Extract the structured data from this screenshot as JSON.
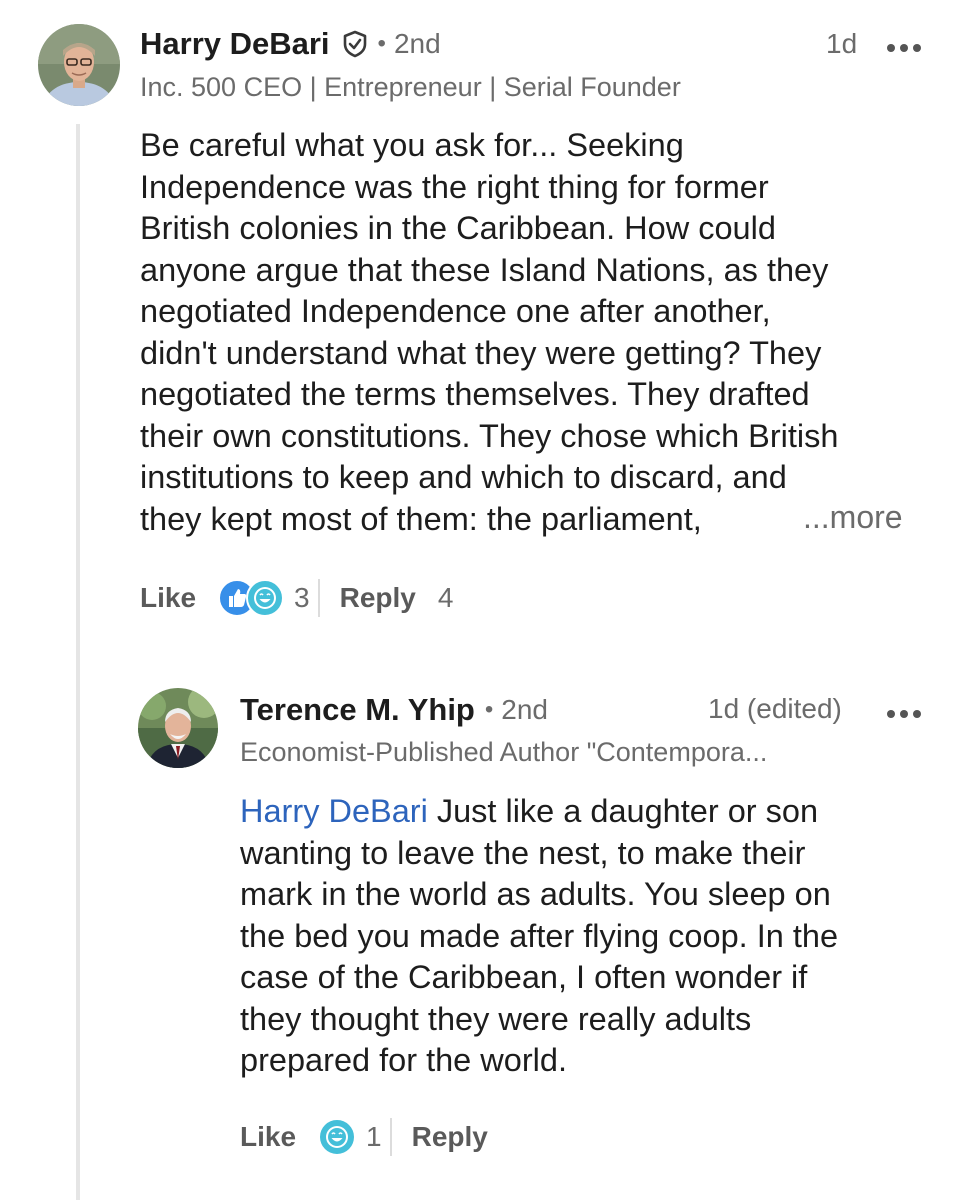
{
  "comment": {
    "author": "Harry DeBari",
    "degree": "2nd",
    "separator": "•",
    "time": "1d",
    "headline": "Inc. 500 CEO | Entrepreneur | Serial Founder",
    "body": "Be careful what you ask for... Seeking\nIndependence was the right thing for former\nBritish colonies in the Caribbean. How could\nanyone argue that these Island Nations, as they\nnegotiated Independence one after another,\ndidn't understand what they were getting? They\nnegotiated the terms themselves. They drafted\ntheir own constitutions. They chose which British\ninstitutions to keep and which to discard, and\nthey kept most of them: the parliament,",
    "more_label": "...more",
    "like_label": "Like",
    "reaction_count": "3",
    "reply_label": "Reply",
    "reply_count": "4",
    "icons": [
      "verified-shield-icon",
      "more-options-icon",
      "like-reaction-icon",
      "funny-reaction-icon"
    ]
  },
  "reply": {
    "author": "Terence M. Yhip",
    "degree": "2nd",
    "separator": "•",
    "time": "1d (edited)",
    "headline": "Economist-Published Author \"Contempora...",
    "mention": "Harry DeBari",
    "body_first_line": " Just like a daughter or son",
    "body_rest": "wanting to leave the nest, to make their\nmark in the world as adults. You sleep on\nthe bed you made after flying coop. In the\ncase of the Caribbean, I often wonder if\nthey thought they were really adults\nprepared for the world.",
    "like_label": "Like",
    "reaction_count": "1",
    "reply_label": "Reply",
    "icons": [
      "more-options-icon",
      "funny-reaction-icon"
    ]
  },
  "colors": {
    "text": "#1d1d1d",
    "secondary_text": "#6b6b6b",
    "mention": "#2d64bc",
    "like_blue": "#378fe9",
    "funny_teal": "#44bfd9",
    "thread_line": "#e5e5e5"
  }
}
